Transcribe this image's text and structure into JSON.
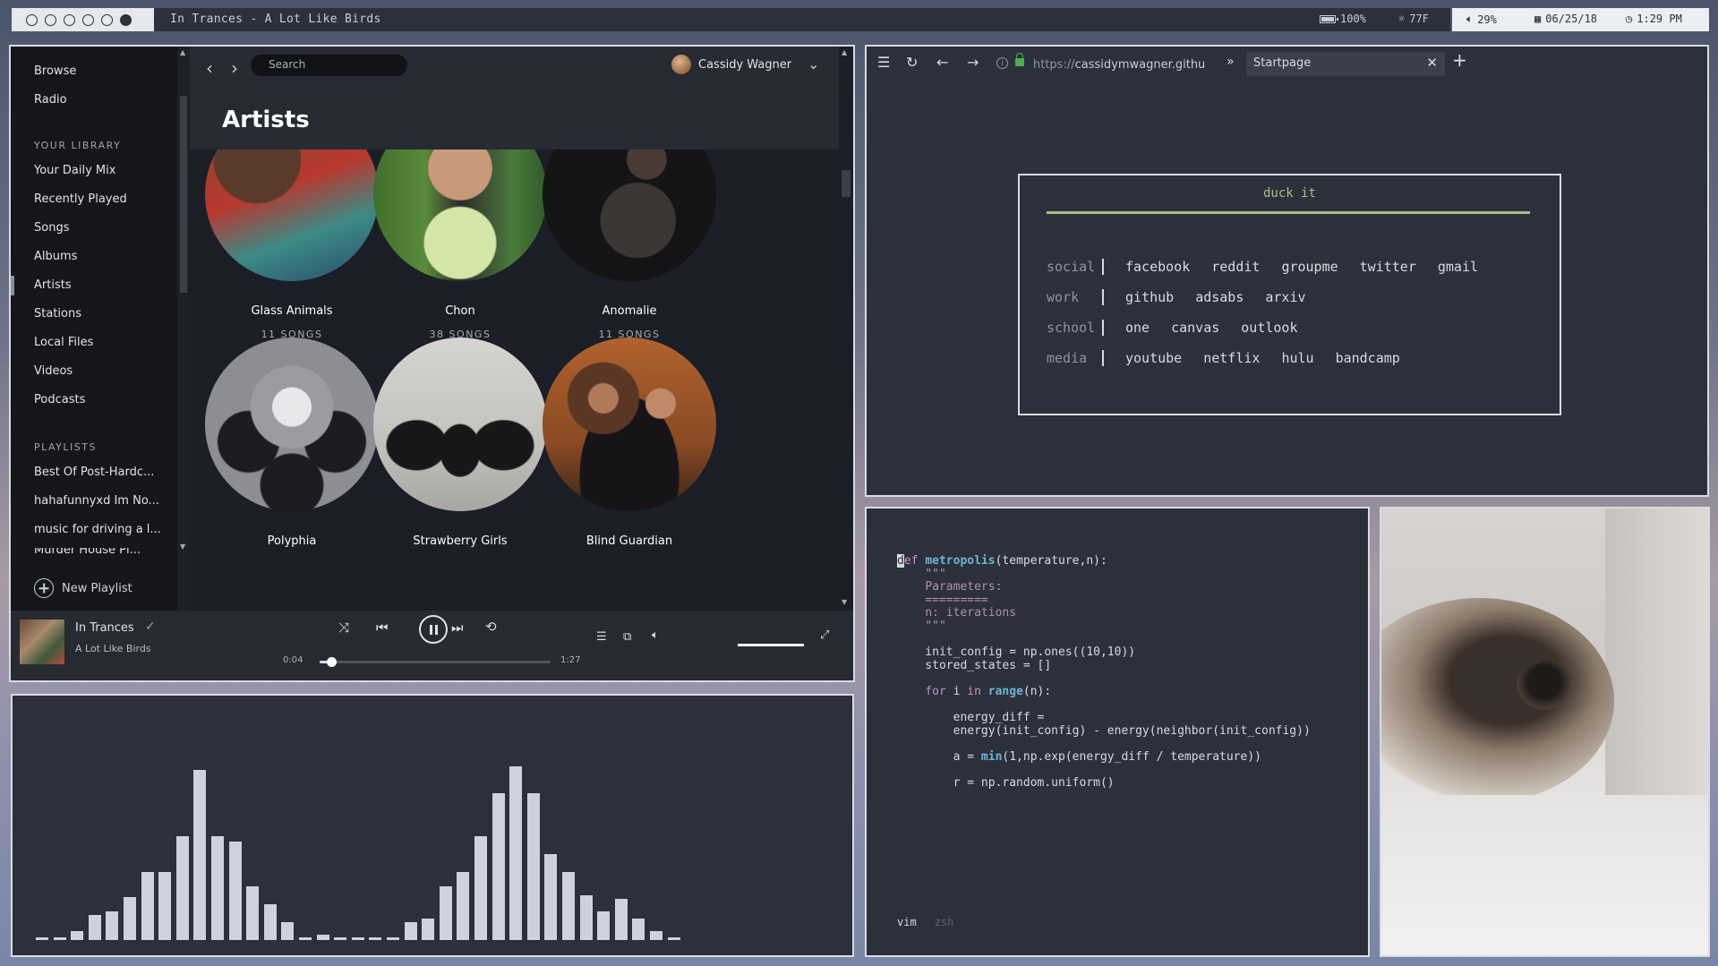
{
  "topbar": {
    "workspaces": [
      false,
      false,
      false,
      false,
      false,
      true
    ],
    "window_title": "In Trances - A Lot Like Birds",
    "battery": "100%",
    "weather": "77F",
    "volume": "29%",
    "date": "06/25/18",
    "time": "1:29 PM"
  },
  "spotify": {
    "nav": {
      "browse": "Browse",
      "radio": "Radio"
    },
    "library_header": "YOUR LIBRARY",
    "library": [
      "Your Daily Mix",
      "Recently Played",
      "Songs",
      "Albums",
      "Artists",
      "Stations",
      "Local Files",
      "Videos",
      "Podcasts"
    ],
    "playlists_header": "PLAYLISTS",
    "playlists": [
      "Best Of Post-Hardc...",
      "hahafunnyxd Im No...",
      "music for driving a l...",
      "Murder House Pl..."
    ],
    "new_playlist": "New Playlist",
    "search_placeholder": "Search",
    "user_name": "Cassidy Wagner",
    "page_title": "Artists",
    "artists": [
      {
        "name": "Glass Animals",
        "songs": "11 SONGS"
      },
      {
        "name": "Chon",
        "songs": "38 SONGS"
      },
      {
        "name": "Anomalie",
        "songs": "11 SONGS"
      },
      {
        "name": "Polyphia",
        "songs": ""
      },
      {
        "name": "Strawberry Girls",
        "songs": ""
      },
      {
        "name": "Blind Guardian",
        "songs": ""
      }
    ],
    "player": {
      "track": "In Trances",
      "artist": "A Lot Like Birds",
      "elapsed": "0:04",
      "duration": "1:27",
      "progress": 0.05,
      "volume": 1.0
    }
  },
  "visualizer": {
    "levels": [
      0.01,
      0.015,
      0.05,
      0.14,
      0.16,
      0.24,
      0.38,
      0.38,
      0.58,
      0.95,
      0.58,
      0.55,
      0.3,
      0.2,
      0.1,
      0.01,
      0.03,
      0.01,
      0.01,
      0.01,
      0.01,
      0.1,
      0.12,
      0.3,
      0.38,
      0.58,
      0.82,
      0.97,
      0.82,
      0.48,
      0.38,
      0.25,
      0.16,
      0.23,
      0.12,
      0.05,
      0.01
    ]
  },
  "browser": {
    "url_prefix": "https://",
    "url_host": "cassidymwagner.githu",
    "tab_title": "Startpage",
    "search_title": "duck it",
    "accent": "#a7c080",
    "rows": [
      {
        "category": "social",
        "links": [
          "facebook",
          "reddit",
          "groupme",
          "twitter",
          "gmail"
        ]
      },
      {
        "category": "work",
        "links": [
          "github",
          "adsabs",
          "arxiv"
        ]
      },
      {
        "category": "school",
        "links": [
          "one",
          "canvas",
          "outlook"
        ]
      },
      {
        "category": "media",
        "links": [
          "youtube",
          "netflix",
          "hulu",
          "bandcamp"
        ]
      }
    ]
  },
  "terminal": {
    "tabs": [
      "vim",
      "zsh"
    ]
  }
}
